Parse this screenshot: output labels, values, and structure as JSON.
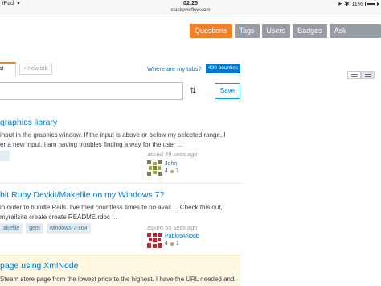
{
  "status_bar": {
    "device": "iPad",
    "time": "02:25",
    "battery": "11%"
  },
  "browser": {
    "url": "stackoverflow.com"
  },
  "nav": {
    "questions": "Questions",
    "tags": "Tags",
    "users": "Users",
    "badges": "Badges",
    "ask": "Ask Question"
  },
  "tabs": {
    "current": "st",
    "new_tab": "+ new tab",
    "where": "Where are my tabs?",
    "bounties": "430 bounties"
  },
  "filter": {
    "save": "Save",
    "sort_icon": "sort-arrows-icon"
  },
  "questions": [
    {
      "title": "graphics library",
      "excerpt_1": "input in the graphics window. If the input is above or below my selected range, I",
      "excerpt_2": "er a new input. I am having troubles finding a way for the user ...",
      "tags": [],
      "asked": "asked 49 secs ago",
      "user": "John",
      "rep": "4",
      "bronze": "1"
    },
    {
      "title": "bit Ruby Devkit/Makefile on my Windows 7?",
      "excerpt_1": "in order to bundle Rails. I've tried countless times to no avail.... Check this out,",
      "excerpt_2": "myrailsite create create README.rdoc ...",
      "tags": [
        "akefile",
        "gem",
        "windows-7-x64"
      ],
      "asked": "asked 55 secs ago",
      "user": "PablosANoob",
      "rep": "4",
      "bronze": "1"
    },
    {
      "title": "page using XmlNode",
      "excerpt_1": "Steam store page from the lowest price to the highest. I have the URL needed and",
      "excerpt_2": "",
      "tags": [],
      "asked": "",
      "user": "",
      "rep": "",
      "bronze": ""
    }
  ],
  "colors": {
    "accent": "#f48024",
    "link": "#0077cc",
    "nav_gray": "#959ca3",
    "tag_bg": "#e1ecf4",
    "featured_bg": "#fdf7e2"
  }
}
